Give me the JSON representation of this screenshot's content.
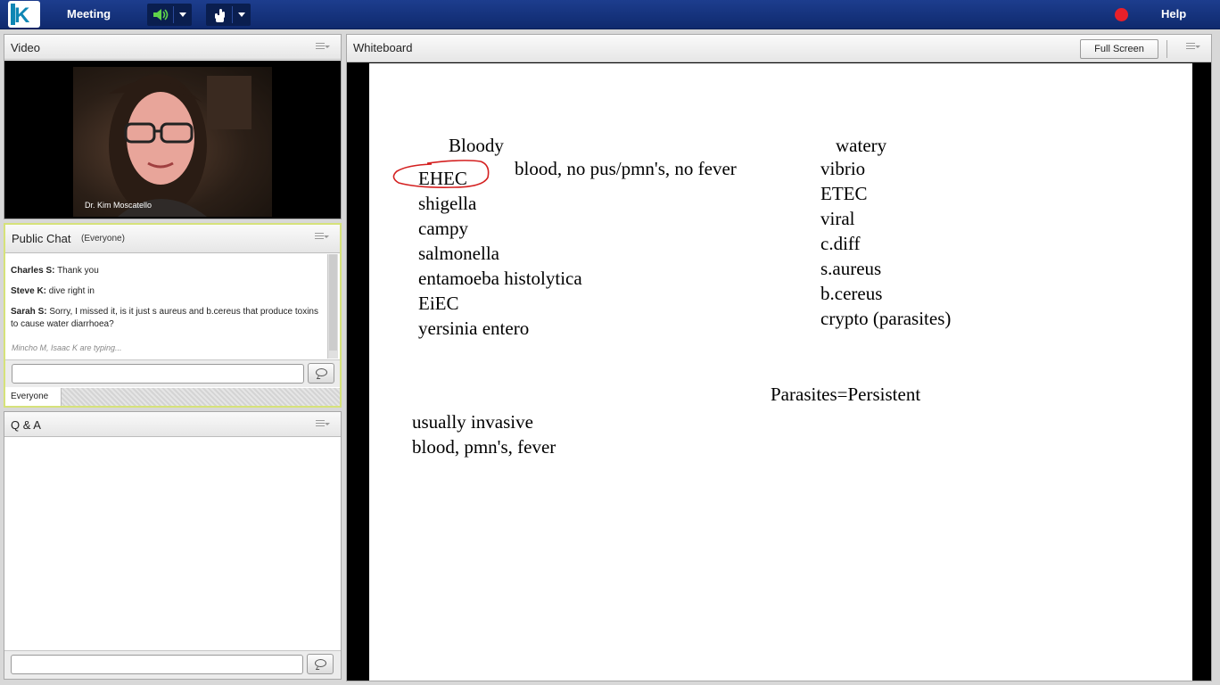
{
  "topbar": {
    "meeting_label": "Meeting",
    "help_label": "Help",
    "audio_icon": "speaker-icon",
    "presenter_icon": "raise-hand-icon",
    "record_color": "#e8202a"
  },
  "video_pod": {
    "title": "Video",
    "presenter_name": "Dr. Kim Moscatello"
  },
  "chat_pod": {
    "title": "Public Chat",
    "audience": "(Everyone)",
    "messages": [
      {
        "sender": "Charles S:",
        "text": "Thank you"
      },
      {
        "sender": "Steve K:",
        "text": "dive right in"
      },
      {
        "sender": "Sarah S:",
        "text": "Sorry, I missed it, is it just s aureus and b.cereus that produce toxins to cause water diarrhoea?"
      }
    ],
    "typing": "Mincho M, Isaac K are typing...",
    "input_value": "",
    "tab_everyone": "Everyone"
  },
  "qa_pod": {
    "title": "Q & A",
    "input_value": ""
  },
  "whiteboard": {
    "title": "Whiteboard",
    "fullscreen_label": "Full Screen",
    "annotation_color": "#d42020",
    "bloody_heading": "Bloody",
    "bloody_note": "blood, no pus/pmn's, no fever",
    "bloody_items": [
      "EHEC",
      "shigella",
      "campy",
      "salmonella",
      "entamoeba histolytica",
      "EiEC",
      "yersinia entero"
    ],
    "watery_heading": "watery",
    "watery_items": [
      "vibrio",
      "ETEC",
      "viral",
      "c.diff",
      "s.aureus",
      "b.cereus",
      "crypto (parasites)"
    ],
    "parasites_note": "Parasites=Persistent",
    "invasive_line1": "usually invasive",
    "invasive_line2": "blood, pmn's, fever"
  }
}
